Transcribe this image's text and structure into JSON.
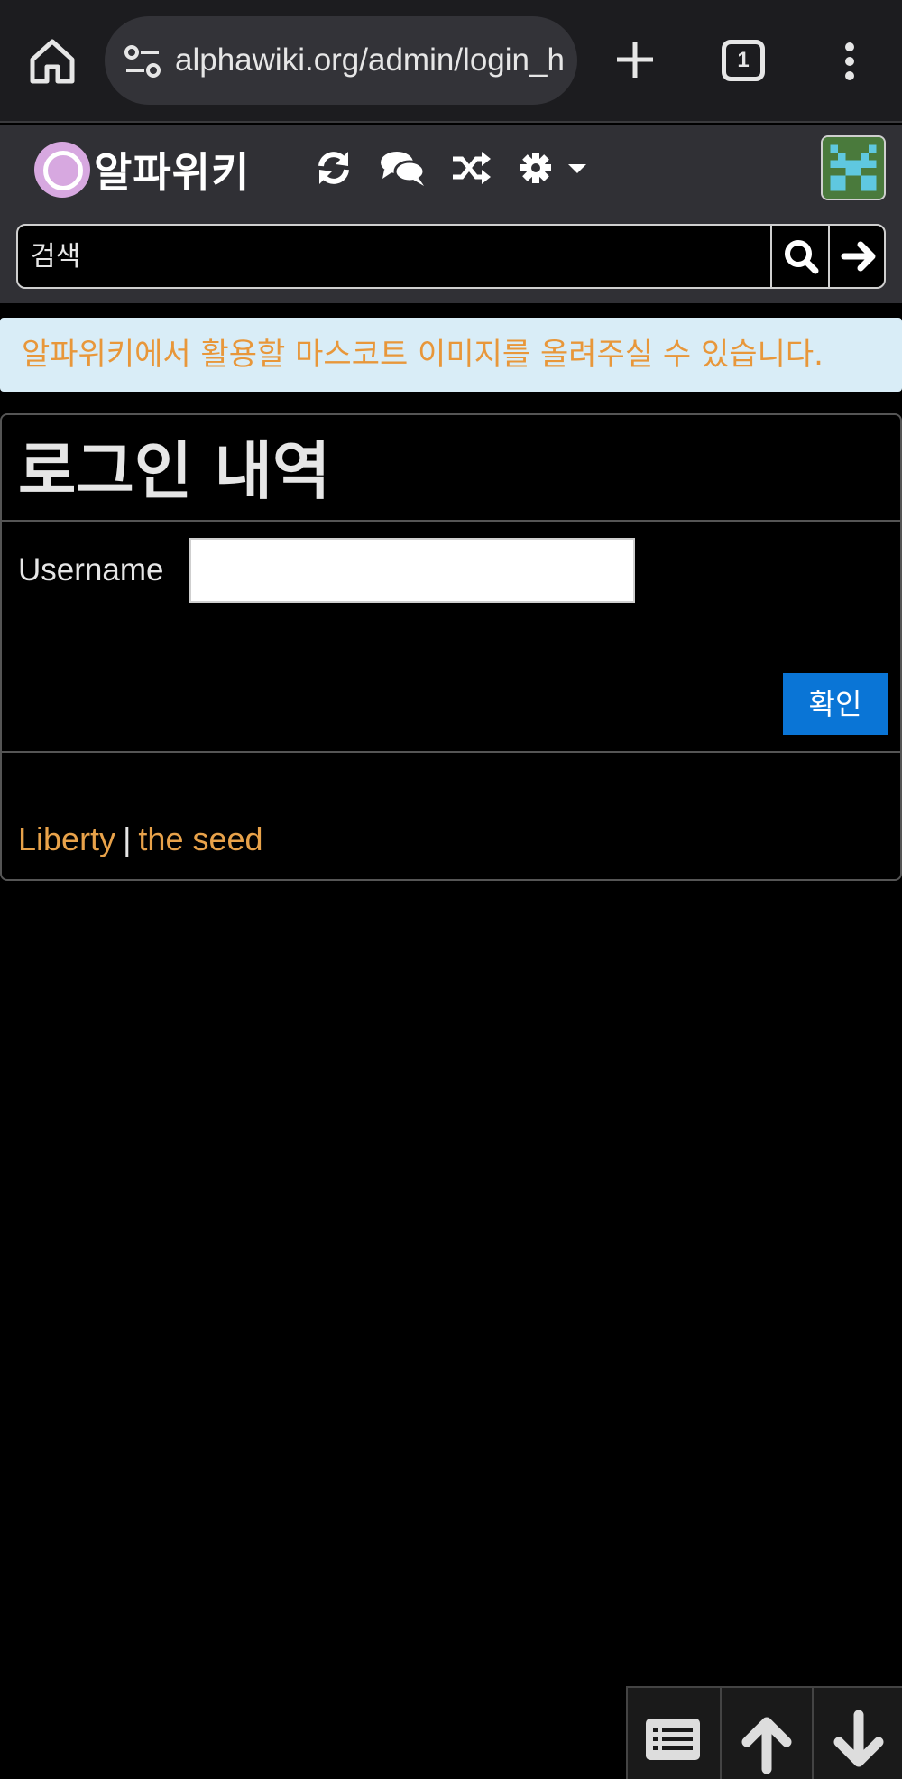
{
  "browser": {
    "url": "alphawiki.org/admin/login_h",
    "tab_count": "1"
  },
  "wiki": {
    "logo_text": "알파위키",
    "search_placeholder": "검색"
  },
  "notice": {
    "text": "알파위키에서 활용할 마스코트 이미지를 올려주실 수 있습니다."
  },
  "page": {
    "title": "로그인 내역",
    "username_label": "Username",
    "username_value": "",
    "confirm_label": "확인"
  },
  "footer": {
    "links": [
      "Liberty",
      "the seed"
    ],
    "separator": "|"
  },
  "colors": {
    "accent_orange": "#e8a24a",
    "primary_blue": "#0a75d6",
    "notice_bg": "#d9edf7",
    "nav_bg": "#303035"
  },
  "icons": [
    "home-icon",
    "site-settings-icon",
    "new-tab-icon",
    "tab-switcher-icon",
    "more-menu-icon",
    "recent-changes-icon",
    "discussion-icon",
    "random-icon",
    "settings-icon",
    "search-icon",
    "go-arrow-icon",
    "toc-icon",
    "scroll-up-icon",
    "scroll-down-icon"
  ]
}
